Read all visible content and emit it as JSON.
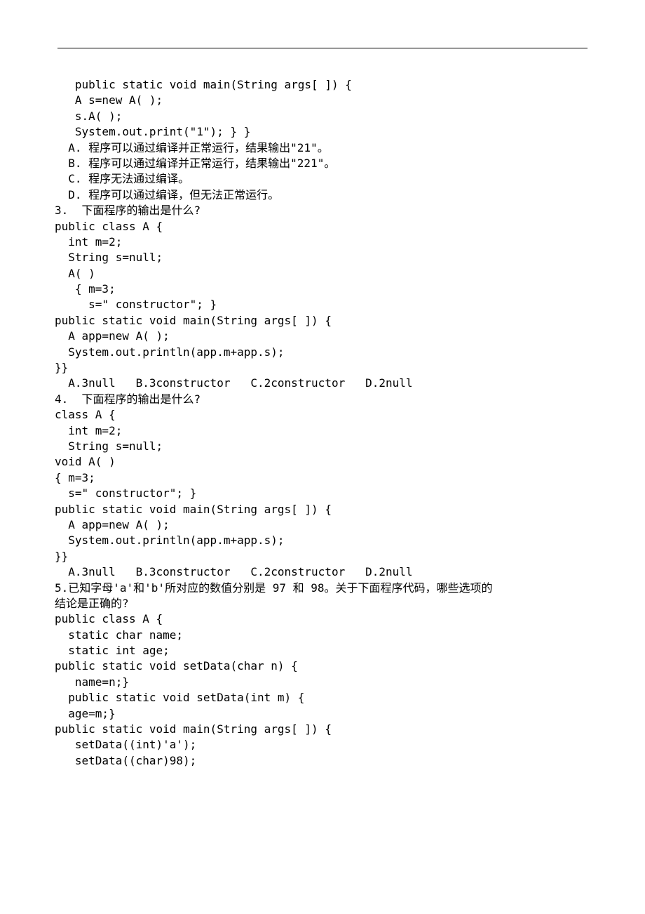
{
  "lines": [
    "   public static void main(String args[ ]) {",
    "   A s=new A( );",
    "   s.A( );",
    "   System.out.print(\"1\"); } }",
    "  A. 程序可以通过编译并正常运行，结果输出\"21\"。",
    "  B. 程序可以通过编译并正常运行，结果输出\"221\"。",
    "  C. 程序无法通过编译。",
    "  D. 程序可以通过编译，但无法正常运行。",
    "3.  下面程序的输出是什么?",
    "public class A {",
    "  int m=2;",
    "  String s=null;",
    "  A( )",
    "   { m=3;",
    "     s=\" constructor\"; }",
    "public static void main(String args[ ]) {",
    "  A app=new A( );",
    "  System.out.println(app.m+app.s);",
    "}}",
    "  A.3null   B.3constructor   C.2constructor   D.2null",
    "4.  下面程序的输出是什么?",
    "class A {",
    "  int m=2;",
    "  String s=null;",
    "void A( )",
    "{ m=3;",
    "  s=\" constructor\"; }",
    "public static void main(String args[ ]) {",
    "  A app=new A( );",
    "  System.out.println(app.m+app.s);",
    "}}",
    "  A.3null   B.3constructor   C.2constructor   D.2null",
    "5.已知字母'a'和'b'所对应的数值分别是 97 和 98。关于下面程序代码，哪些选项的",
    "结论是正确的?",
    "public class A {",
    "  static char name;",
    "  static int age;",
    "public static void setData(char n) {",
    "   name=n;}",
    "  public static void setData(int m) {",
    "  age=m;}",
    "public static void main(String args[ ]) {",
    "   setData((int)'a');",
    "   setData((char)98);"
  ]
}
